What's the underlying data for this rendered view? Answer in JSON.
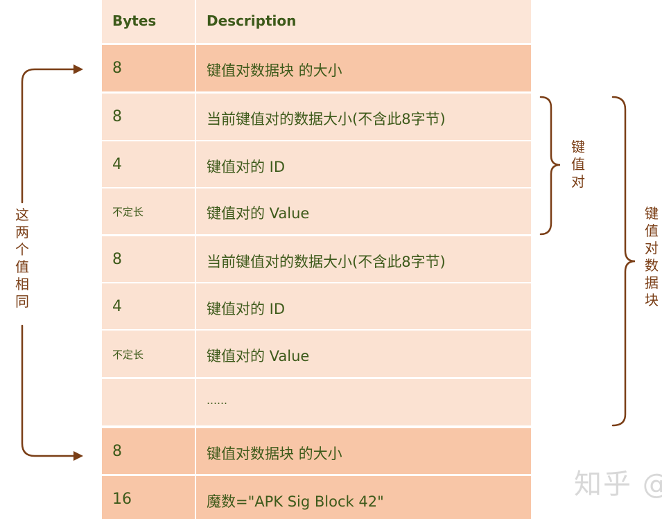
{
  "header": {
    "bytes": "Bytes",
    "description": "Description"
  },
  "rows": [
    {
      "bytes": "8",
      "description": "键值对数据块 的大小"
    },
    {
      "bytes": "8",
      "description": "当前键值对的数据大小(不含此8字节)"
    },
    {
      "bytes": "4",
      "description": "键值对的 ID"
    },
    {
      "bytes": "不定长",
      "description": "键值对的 Value"
    },
    {
      "bytes": "8",
      "description": "当前键值对的数据大小(不含此8字节)"
    },
    {
      "bytes": "4",
      "description": "键值对的 ID"
    },
    {
      "bytes": "不定长",
      "description": "键值对的 Value"
    },
    {
      "bytes": "",
      "description": "……"
    },
    {
      "bytes": "8",
      "description": "键值对数据块 的大小"
    },
    {
      "bytes": "16",
      "description": "魔数=\"APK Sig Block 42\""
    }
  ],
  "annotations": {
    "left_same": "这两个值相同",
    "key_value_pair": "键值对",
    "key_value_block": "键值对数据块"
  },
  "watermark": "知乎 @",
  "colors": {
    "header_bg": "#fce6d8",
    "light_bg": "#fbe2d2",
    "dark_bg": "#f8c6a7",
    "text": "#3d5a1a",
    "bracket": "#7a3e16"
  }
}
